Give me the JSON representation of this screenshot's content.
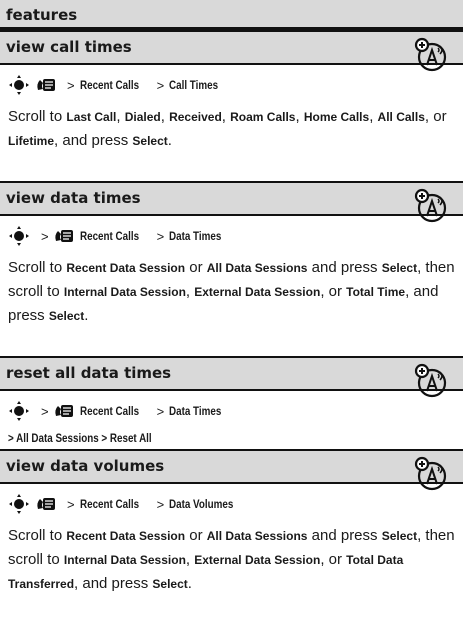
{
  "header": {
    "title": "features"
  },
  "sections": [
    {
      "title": "view call times",
      "path": [
        {
          "label": "",
          "kind": "nav"
        },
        {
          "label": "",
          "kind": "menu"
        },
        {
          "label": ">",
          "kind": "sep"
        },
        {
          "label": "Recent Calls",
          "kind": "item"
        },
        {
          "label": ">",
          "kind": "sep"
        },
        {
          "label": "Call Times",
          "kind": "item"
        }
      ],
      "body": [
        {
          "t": "Scroll to "
        },
        {
          "b": "Last Call"
        },
        {
          "t": ", "
        },
        {
          "b": "Dialed"
        },
        {
          "t": ", "
        },
        {
          "b": "Received"
        },
        {
          "t": ", "
        },
        {
          "b": "Roam Calls"
        },
        {
          "t": ", "
        },
        {
          "b": "Home Calls"
        },
        {
          "t": ", "
        },
        {
          "b": "All Calls"
        },
        {
          "t": ", or "
        },
        {
          "b": "Lifetime"
        },
        {
          "t": ", and press "
        },
        {
          "b": "Select"
        },
        {
          "t": "."
        }
      ]
    },
    {
      "title": "view data times",
      "path_line2": "",
      "body": [
        {
          "t": "Scroll to "
        },
        {
          "b": "Recent Data Session"
        },
        {
          "t": " or "
        },
        {
          "b": "All Data Sessions"
        },
        {
          "t": " and press "
        },
        {
          "b": "Select"
        },
        {
          "t": ", then scroll to "
        },
        {
          "b": "Internal Data Session"
        },
        {
          "t": ", "
        },
        {
          "b": "External Data Session"
        },
        {
          "t": ", or "
        },
        {
          "b": "Total Time"
        },
        {
          "t": ", and press "
        },
        {
          "b": "Select"
        },
        {
          "t": "."
        }
      ]
    },
    {
      "title": "reset all data times",
      "path_line2": "> All Data Sessions > Reset All"
    },
    {
      "title": "view data volumes",
      "body": [
        {
          "t": "Scroll to "
        },
        {
          "b": "Recent Data Session"
        },
        {
          "t": " or "
        },
        {
          "b": "All Data Sessions"
        },
        {
          "t": " and press "
        },
        {
          "b": "Select"
        },
        {
          "t": ", then scroll to "
        },
        {
          "b": "Internal Data Session"
        },
        {
          "t": ", "
        },
        {
          "b": "External Data Session"
        },
        {
          "t": ", or "
        },
        {
          "b": "Total Data Transferred"
        },
        {
          "t": ", and press "
        },
        {
          "b": "Select"
        },
        {
          "t": "."
        }
      ]
    }
  ],
  "labels": {
    "recent_calls": "Recent Calls",
    "call_times": "Call Times",
    "data_times": "Data Times",
    "data_volumes": "Data Volumes",
    "sep": ">",
    "all_data_sessions": "All Data Sessions",
    "reset_all": "Reset All"
  }
}
